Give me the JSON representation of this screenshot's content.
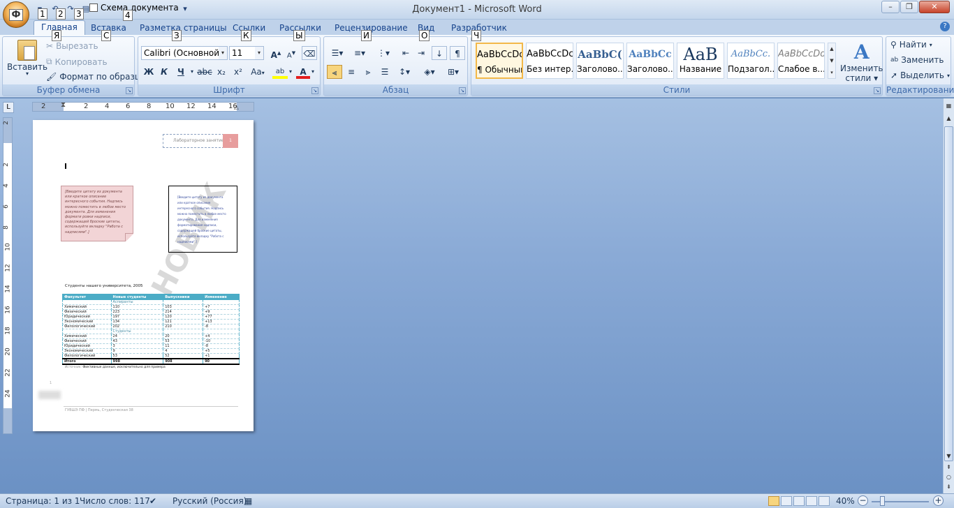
{
  "window": {
    "title": "Документ1 - Microsoft Word",
    "office_button_keytip": "Ф",
    "qat_keytips": [
      "1",
      "2",
      "3",
      "4"
    ],
    "doc_map_label": "Схема документа"
  },
  "tabs": [
    {
      "label": "Главная",
      "keytip": "Я"
    },
    {
      "label": "Вставка",
      "keytip": "С"
    },
    {
      "label": "Разметка страницы",
      "keytip": "З"
    },
    {
      "label": "Ссылки",
      "keytip": "К"
    },
    {
      "label": "Рассылки",
      "keytip": "Ы"
    },
    {
      "label": "Рецензирование",
      "keytip": "И"
    },
    {
      "label": "Вид",
      "keytip": "О"
    },
    {
      "label": "Разработчик",
      "keytip": "Ч"
    }
  ],
  "clipboard": {
    "group_label": "Буфер обмена",
    "paste": "Вставить",
    "cut": "Вырезать",
    "copy": "Копировать",
    "format_painter": "Формат по образцу"
  },
  "font": {
    "group_label": "Шрифт",
    "font_name": "Calibri (Основной те",
    "font_size": "11",
    "bold": "Ж",
    "italic": "К",
    "underline": "Ч",
    "strike": "abc",
    "subscript": "x₂",
    "superscript": "x²",
    "change_case": "Aa",
    "grow": "A",
    "shrink": "A",
    "font_color_glyph": "A",
    "highlight_glyph": "ab"
  },
  "paragraph": {
    "group_label": "Абзац",
    "pilcrow": "¶"
  },
  "styles": {
    "group_label": "Стили",
    "items": [
      {
        "preview": "AaBbCcDc",
        "name": "¶ Обычный"
      },
      {
        "preview": "AaBbCcDc",
        "name": "Без интер..."
      },
      {
        "preview": "AaBbC(",
        "name": "Заголово..."
      },
      {
        "preview": "AaBbCc",
        "name": "Заголово..."
      },
      {
        "preview": "AaB",
        "name": "Название"
      },
      {
        "preview": "AaBbCc.",
        "name": "Подзагол..."
      },
      {
        "preview": "AaBbCcDd",
        "name": "Слабое в..."
      }
    ],
    "change_styles_line1": "Изменить",
    "change_styles_line2": "стили"
  },
  "editing": {
    "group_label": "Редактирование",
    "find": "Найти",
    "replace": "Заменить",
    "select": "Выделить"
  },
  "ruler": {
    "h_numbers": [
      "2",
      "2",
      "4",
      "6",
      "8",
      "10",
      "12",
      "14",
      "16"
    ],
    "v_numbers": [
      "2",
      "2",
      "4",
      "6",
      "8",
      "10",
      "12",
      "14",
      "16",
      "18",
      "20",
      "22",
      "24"
    ]
  },
  "document": {
    "header_text": "Лабораторное занятие 1",
    "header_number": "1",
    "pink_note": "[Введите цитату из документа или краткое описание интересного события. Надпись можно поместить в любое место документа. Для изменения формати ровки надписи, содержащей броские цитаты, используйте вкладку \"Работа с надписями\".]",
    "box_note": "[Введите цитату из документа или краткое описание интересного события. Надпись можно поместить в любое место документа. Для изменения форматирования надписи, содержащей броские цитаты, используйте вкладку \"Работа с надписями\".]",
    "watermark": "НОВИК",
    "table_title": "Студенты нашего университета, 2005",
    "table": {
      "headers": [
        "Факультет",
        "Новые студенты",
        "Выпускники",
        "Изменение"
      ],
      "sections": [
        {
          "label": "Аспиранты",
          "rows": [
            [
              "Химический",
              "110",
              "103",
              "+7"
            ],
            [
              "Физический",
              "223",
              "214",
              "+9"
            ],
            [
              "Юридический",
              "197",
              "120",
              "+77"
            ],
            [
              "Экономический",
              "134",
              "121",
              "+13"
            ],
            [
              "Филологический",
              "202",
              "210",
              "-8"
            ]
          ]
        },
        {
          "label": "Студенты",
          "rows": [
            [
              "Химический",
              "24",
              "20",
              "+4"
            ],
            [
              "Физический",
              "43",
              "53",
              "-10"
            ],
            [
              "Юридический",
              "3",
              "11",
              "-8"
            ],
            [
              "Экономический",
              "9",
              "4",
              "+5"
            ],
            [
              "Филологический",
              "53",
              "52",
              "+1"
            ]
          ]
        }
      ],
      "total": [
        "Итого",
        "998",
        "908",
        "90"
      ]
    },
    "source_label": "Источник:",
    "source_text": "Фиктивные данные, исключительно для примера",
    "footer": "ГУВШЭ ПФ | Пермь, Студенческая 38",
    "page_marker": "1"
  },
  "statusbar": {
    "page": "Страница: 1 из 1",
    "words": "Число слов: 117",
    "language": "Русский (Россия)",
    "zoom": "40%"
  }
}
